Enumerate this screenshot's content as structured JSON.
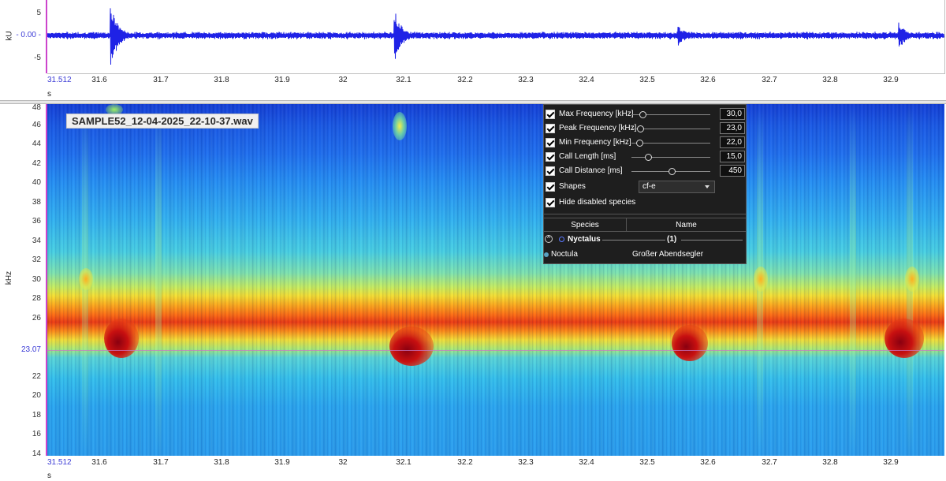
{
  "waveform": {
    "y_unit": "kU",
    "y_ticks": [
      "5",
      "- 0.00 -",
      "-5"
    ],
    "x_start": "31.512",
    "x_ticks": [
      "31.6",
      "31.7",
      "31.8",
      "31.9",
      "32",
      "32.1",
      "32.2",
      "32.3",
      "32.4",
      "32.5",
      "32.6",
      "32.7",
      "32.8",
      "32.9"
    ],
    "x_unit": "s",
    "trace_color": "#1f22e6"
  },
  "spectrogram": {
    "file_name": "SAMPLE52_12-04-2025_22-10-37.wav",
    "y_unit": "kHz",
    "y_ticks": [
      "48",
      "46",
      "44",
      "42",
      "40",
      "38",
      "36",
      "34",
      "32",
      "30",
      "28",
      "26",
      "22",
      "20",
      "18",
      "16",
      "14"
    ],
    "cursor_value": "23.07",
    "x_start": "31.512",
    "x_ticks": [
      "31.6",
      "31.7",
      "31.8",
      "31.9",
      "32",
      "32.1",
      "32.2",
      "32.3",
      "32.4",
      "32.5",
      "32.6",
      "32.7",
      "32.8",
      "32.9"
    ],
    "x_unit": "s"
  },
  "filter_panel": {
    "params": [
      {
        "label": "Max Frequency [kHz]",
        "value": "30,0",
        "checked": true
      },
      {
        "label": "Peak Frequency [kHz]",
        "value": "23,0",
        "checked": true
      },
      {
        "label": "Min Frequency [kHz]",
        "value": "22,0",
        "checked": true
      },
      {
        "label": "Call Length [ms]",
        "value": "15,0",
        "checked": true
      },
      {
        "label": "Call Distance [ms]",
        "value": "450",
        "checked": true
      }
    ],
    "shapes_label": "Shapes",
    "shapes_value": "cf-e",
    "hide_disabled_label": "Hide disabled species",
    "table": {
      "headers": [
        "Species",
        "Name"
      ],
      "group": {
        "name": "Nyctalus",
        "count": "(1)"
      },
      "rows": [
        {
          "species": "Noctula",
          "name": "Großer Abendsegler"
        }
      ]
    }
  }
}
